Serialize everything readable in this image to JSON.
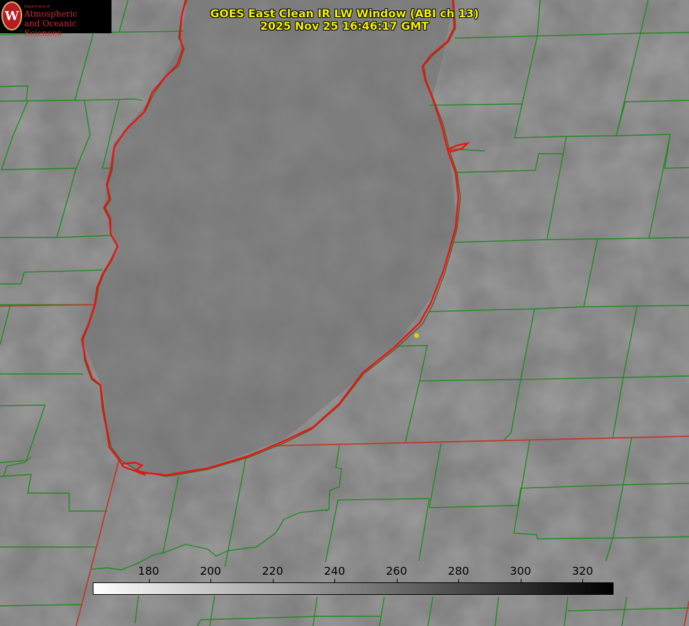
{
  "title": {
    "line1": "GOES East Clean IR LW Window (ABI ch 13)",
    "line2": "2025 Nov 25 16:46:17 GMT"
  },
  "logo": {
    "seal_letter": "W",
    "dept": "Department of",
    "line1": "Atmospheric",
    "line2": "and Oceanic Sciences"
  },
  "colorbar": {
    "min": 162,
    "max": 330,
    "ticks": [
      "180",
      "200",
      "220",
      "240",
      "260",
      "280",
      "300",
      "320"
    ],
    "gradient": [
      "#ffffff",
      "#000000"
    ]
  },
  "colors": {
    "background_gray": "#7b7b7b",
    "county_lines": "#1f8a1f",
    "state_lines": "#c0392b",
    "shoreline": "#ee1111",
    "title_text": "#f2f200",
    "marker": "#d6cf1a"
  },
  "features": {
    "lake": "lake outline",
    "marker": "yellow station dot"
  }
}
